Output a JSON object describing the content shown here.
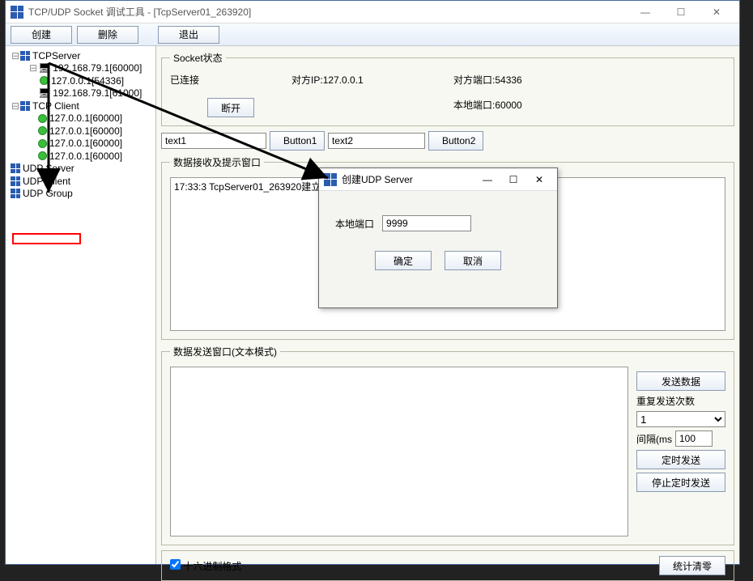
{
  "title": "TCP/UDP Socket 调试工具 - [TcpServer01_263920]",
  "toolbar": {
    "create": "创建",
    "delete": "删除",
    "exit": "退出"
  },
  "tree": {
    "tcpServer": "TCPServer",
    "ts_items": [
      "192.168.79.1[60000]",
      "127.0.0.1[54336]",
      "192.168.79.1[61000]"
    ],
    "tcpClient": "TCP Client",
    "tc_items": [
      "127.0.0.1[60000]",
      "127.0.0.1[60000]",
      "127.0.0.1[60000]",
      "127.0.0.1[60000]"
    ],
    "udpServer": "UDP Server",
    "udpClient": "UDP Client",
    "udpGroup": "UDP Group"
  },
  "status": {
    "legend": "Socket状态",
    "connected": "已连接",
    "peer_ip_label": "对方IP:",
    "peer_ip": "127.0.0.1",
    "peer_port_label": "对方端口:",
    "peer_port": "54336",
    "local_port_label": "本地端口:",
    "local_port": "60000",
    "disconnect": "断开"
  },
  "inputs": {
    "text1_ph": "text1",
    "button1": "Button1",
    "text2_ph": "text2",
    "button2": "Button2"
  },
  "recv": {
    "legend": "数据接收及提示窗口",
    "line": "17:33:3 TcpServer01_263920建立连"
  },
  "send": {
    "legend": "数据发送窗口(文本模式)",
    "send_btn": "发送数据",
    "repeat_label": "重复发送次数",
    "repeat_val": "1",
    "interval_label": "间隔(ms",
    "interval_val": "100",
    "timed_send": "定时发送",
    "stop_timed": "停止定时发送"
  },
  "bottom": {
    "hex_label": "十六进制格式",
    "stats_clear": "统计清零"
  },
  "dialog": {
    "title": "创建UDP Server",
    "port_label": "本地端口",
    "port_val": "9999",
    "ok": "确定",
    "cancel": "取消"
  }
}
